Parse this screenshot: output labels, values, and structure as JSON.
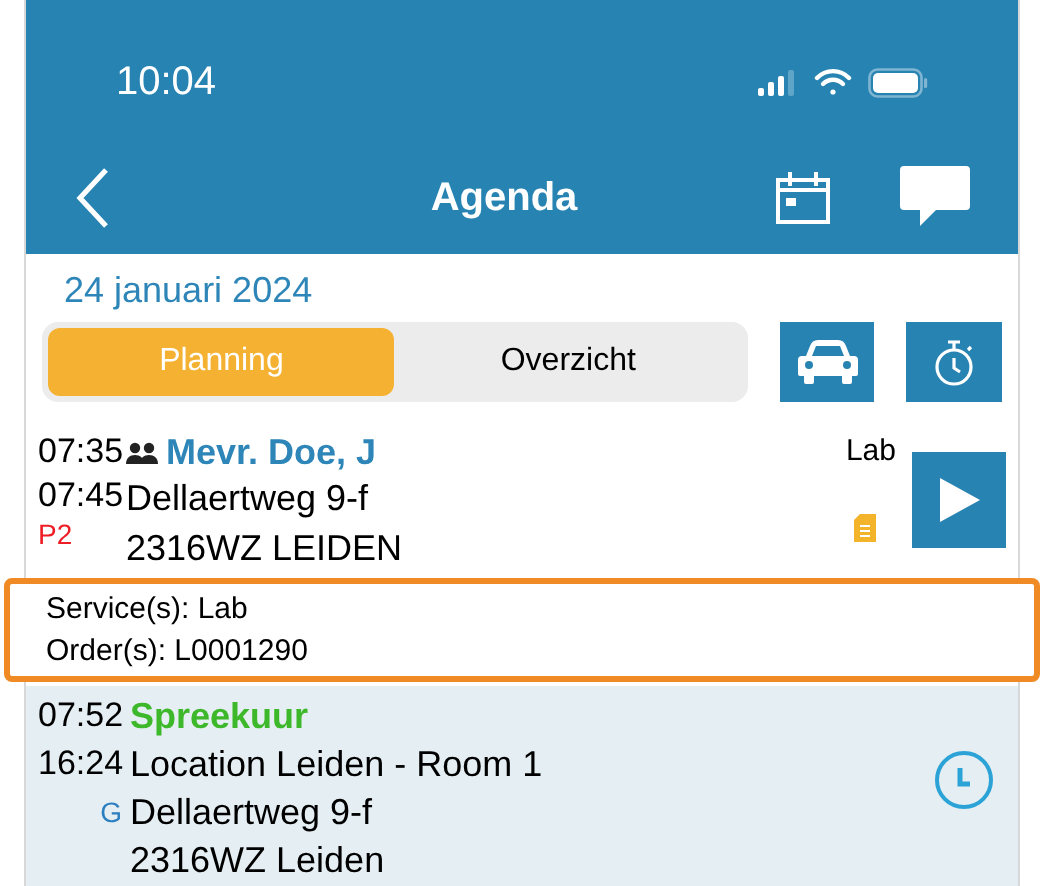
{
  "status_bar": {
    "time": "10:04"
  },
  "nav": {
    "title": "Agenda"
  },
  "date": "24 januari 2024",
  "segments": [
    {
      "label": "Planning",
      "selected": true
    },
    {
      "label": "Overzicht",
      "selected": false
    }
  ],
  "appointments": [
    {
      "kind": "visit",
      "start": "07:35",
      "end": "07:45",
      "priority": "P2",
      "title": "Mevr. Doe, J",
      "color": "#2e86b8",
      "lines": [
        "Dellaertweg 9-f",
        "2316WZ LEIDEN"
      ],
      "tag": "Lab",
      "highlighted": true,
      "details": [
        "Service(s): Lab",
        "Order(s): L0001290"
      ]
    },
    {
      "kind": "consult",
      "start": "07:52",
      "end": "16:24",
      "code": "G",
      "title": "Spreekuur",
      "color": "#3db82a",
      "lines": [
        "Location Leiden - Room 1",
        "Dellaertweg 9-f",
        "2316WZ Leiden"
      ]
    }
  ]
}
